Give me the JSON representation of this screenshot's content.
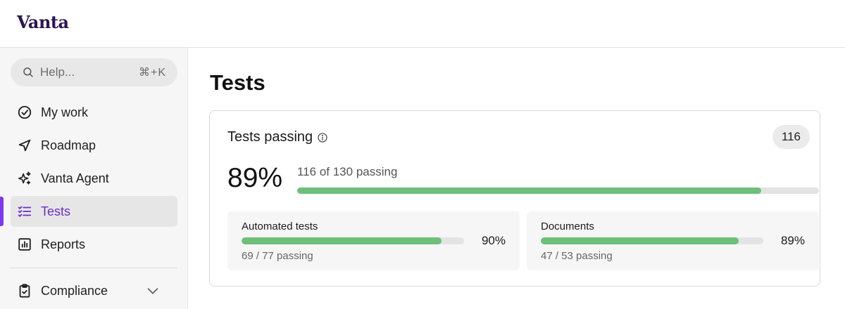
{
  "brand": {
    "logo_text": "Vanta",
    "accent": "#7c3aed",
    "logo_color": "#2b1550"
  },
  "sidebar": {
    "search": {
      "placeholder": "Help...",
      "shortcut": "⌘+K",
      "icon": "search-icon"
    },
    "items": [
      {
        "label": "My work",
        "icon": "check-circle-icon",
        "active": false
      },
      {
        "label": "Roadmap",
        "icon": "navigation-arrow-icon",
        "active": false
      },
      {
        "label": "Vanta Agent",
        "icon": "sparkles-icon",
        "active": false
      },
      {
        "label": "Tests",
        "icon": "checklist-icon",
        "active": true
      },
      {
        "label": "Reports",
        "icon": "bar-chart-icon",
        "active": false
      }
    ],
    "sections": [
      {
        "label": "Compliance",
        "icon": "clipboard-check-icon",
        "expand_icon": "chevron-down-icon"
      }
    ]
  },
  "main": {
    "title": "Tests",
    "card": {
      "title": "Tests passing",
      "info_icon": "info-icon",
      "count_badge": "116",
      "percent_text": "89%",
      "summary_text": "116 of 130 passing",
      "progress": 0.89,
      "progress_color": "#6dbf79",
      "breakdown": [
        {
          "title": "Automated tests",
          "percent_text": "90%",
          "count_text": "69 / 77 passing",
          "progress": 0.9
        },
        {
          "title": "Documents",
          "percent_text": "89%",
          "count_text": "47 / 53 passing",
          "progress": 0.89
        }
      ]
    }
  }
}
